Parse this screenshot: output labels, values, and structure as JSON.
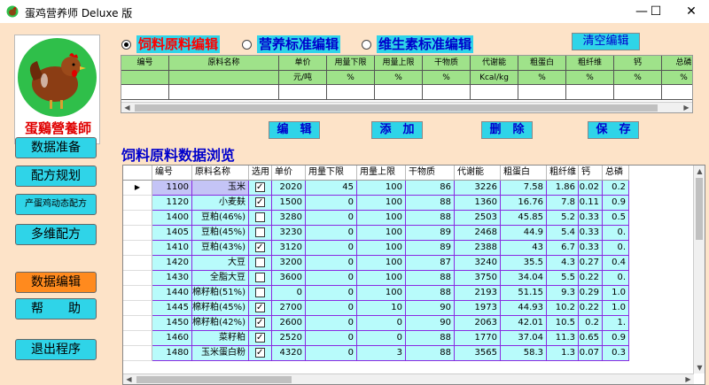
{
  "window": {
    "title": "蛋鸡营养师 Deluxe 版",
    "minimize": "—",
    "maximize": "☐",
    "close": "✕"
  },
  "sidebar": {
    "logo_text": "蛋鷄營養師",
    "buttons": [
      {
        "label": "数据准备"
      },
      {
        "label": "配方规划"
      },
      {
        "label": "产蛋鸡动态配方"
      },
      {
        "label": "多维配方"
      },
      {
        "label": "数据编辑",
        "active": true
      },
      {
        "label": "帮　　助"
      },
      {
        "label": "退出程序"
      }
    ]
  },
  "radios": [
    {
      "label": "饲料原料编辑",
      "checked": true,
      "color": "#ff0000"
    },
    {
      "label": "营养标准编辑",
      "checked": false,
      "color": "#0000cc"
    },
    {
      "label": "维生素标准编辑",
      "checked": false,
      "color": "#0000cc"
    }
  ],
  "clear_button": "清空编辑",
  "edit_table": {
    "headers": [
      "编号",
      "原料名称",
      "单价",
      "用量下限",
      "用量上限",
      "干物质",
      "代谢能",
      "粗蛋白",
      "粗纤维",
      "钙",
      "总磷"
    ],
    "units": [
      "",
      "",
      "元/吨",
      "%",
      "%",
      "%",
      "Kcal/kg",
      "%",
      "%",
      "%",
      "%"
    ]
  },
  "actions": {
    "edit": "编　辑",
    "add": "添　加",
    "delete": "删　除",
    "save": "保　存"
  },
  "section_title": "饲料原料数据浏览",
  "grid": {
    "headers": [
      "编号",
      "原料名称",
      "选用",
      "单价",
      "用量下限",
      "用量上限",
      "干物质",
      "代谢能",
      "粗蛋白",
      "粗纤维",
      "钙",
      "总磷"
    ],
    "rows": [
      [
        "1100",
        "玉米",
        true,
        "2020",
        "45",
        "100",
        "86",
        "3226",
        "7.58",
        "1.86",
        "0.02",
        "0.2"
      ],
      [
        "1120",
        "小麦麸",
        true,
        "1500",
        "0",
        "100",
        "88",
        "1360",
        "16.76",
        "7.8",
        "0.11",
        "0.9"
      ],
      [
        "1400",
        "豆粕(46%)",
        false,
        "3280",
        "0",
        "100",
        "88",
        "2503",
        "45.85",
        "5.2",
        "0.33",
        "0.5"
      ],
      [
        "1405",
        "豆粕(45%)",
        false,
        "3230",
        "0",
        "100",
        "89",
        "2468",
        "44.9",
        "5.4",
        "0.33",
        "0."
      ],
      [
        "1410",
        "豆粕(43%)",
        true,
        "3120",
        "0",
        "100",
        "89",
        "2388",
        "43",
        "6.7",
        "0.33",
        "0."
      ],
      [
        "1420",
        "大豆",
        false,
        "3200",
        "0",
        "100",
        "87",
        "3240",
        "35.5",
        "4.3",
        "0.27",
        "0.4"
      ],
      [
        "1430",
        "全脂大豆",
        false,
        "3600",
        "0",
        "100",
        "88",
        "3750",
        "34.04",
        "5.5",
        "0.22",
        "0."
      ],
      [
        "1440",
        "棉籽粕(51%)",
        false,
        "0",
        "0",
        "100",
        "88",
        "2193",
        "51.15",
        "9.3",
        "0.29",
        "1.0"
      ],
      [
        "1445",
        "棉籽粕(45%)",
        true,
        "2700",
        "0",
        "10",
        "90",
        "1973",
        "44.93",
        "10.2",
        "0.22",
        "1.0"
      ],
      [
        "1450",
        "棉籽粕(42%)",
        true,
        "2600",
        "0",
        "0",
        "90",
        "2063",
        "42.01",
        "10.5",
        "0.2",
        "1."
      ],
      [
        "1460",
        "菜籽粕",
        true,
        "2520",
        "0",
        "0",
        "88",
        "1770",
        "37.04",
        "11.3",
        "0.65",
        "0.9"
      ],
      [
        "1480",
        "玉米蛋白粉",
        true,
        "4320",
        "0",
        "3",
        "88",
        "3565",
        "58.3",
        "1.3",
        "0.07",
        "0.3"
      ]
    ]
  }
}
